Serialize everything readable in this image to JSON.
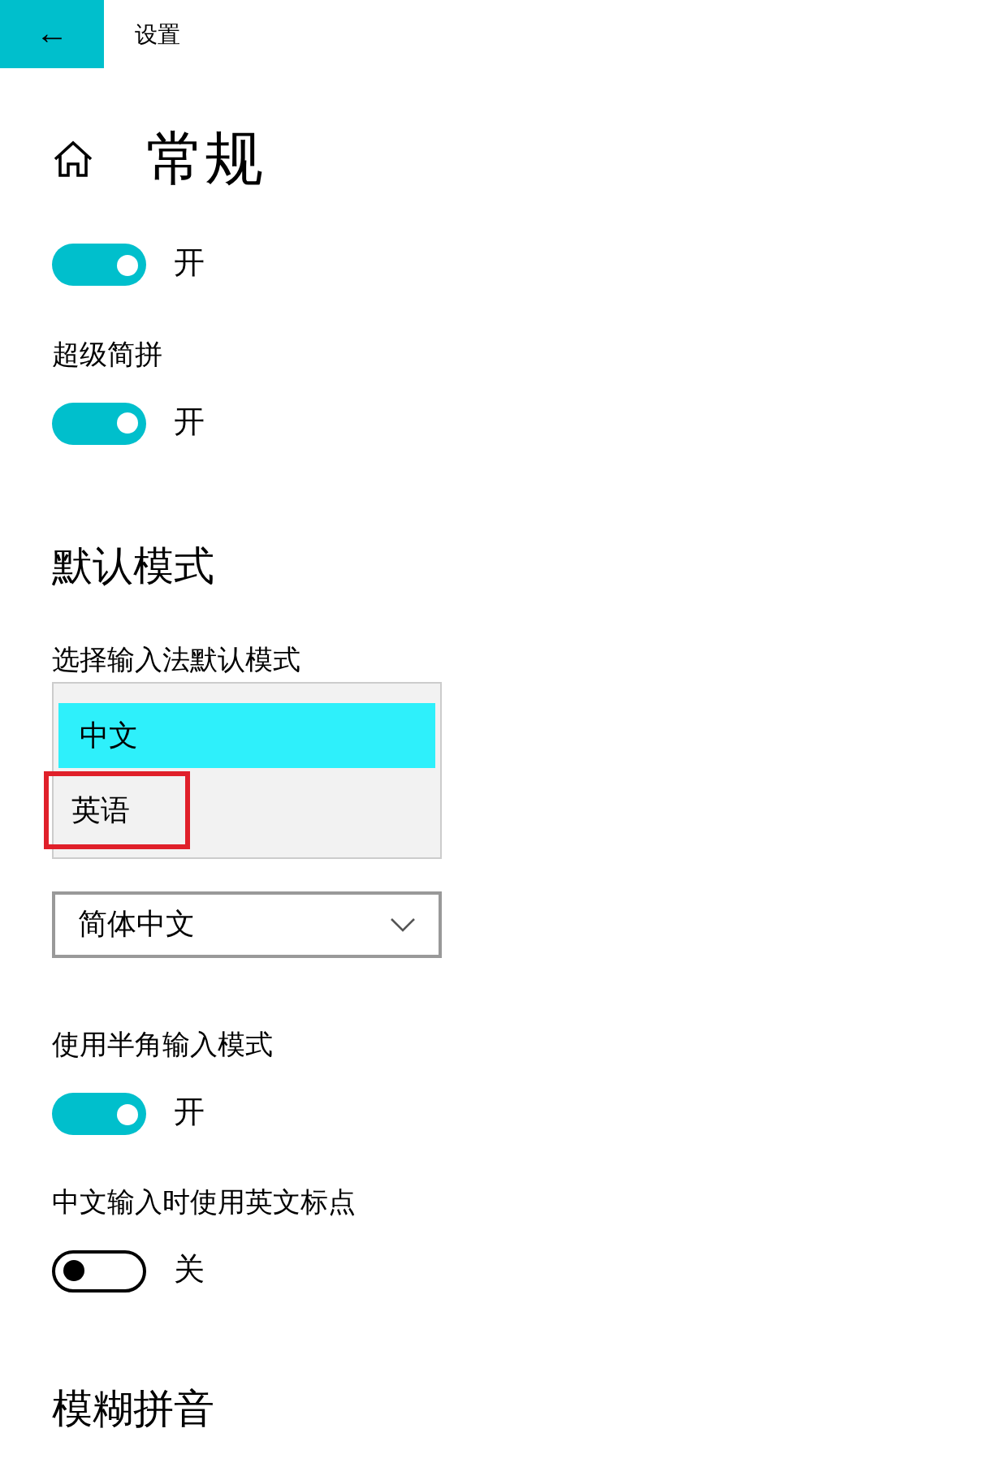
{
  "window": {
    "title": "设置",
    "back": "←"
  },
  "page": {
    "title": "常规"
  },
  "toggles_top": [
    {
      "on": true,
      "state_text": "开"
    },
    {
      "label": "超级简拼",
      "on": true,
      "state_text": "开"
    }
  ],
  "default_mode": {
    "heading": "默认模式",
    "label": "选择输入法默认模式",
    "options": [
      {
        "text": "中文",
        "selected": true,
        "marked": false
      },
      {
        "text": "英语",
        "selected": false,
        "marked": true
      }
    ],
    "charset_value": "简体中文"
  },
  "toggles_bottom": [
    {
      "label": "使用半角输入模式",
      "on": true,
      "state_text": "开"
    },
    {
      "label": "中文输入时使用英文标点",
      "on": false,
      "state_text": "关"
    }
  ],
  "fuzzy": {
    "heading": "模糊拼音"
  }
}
